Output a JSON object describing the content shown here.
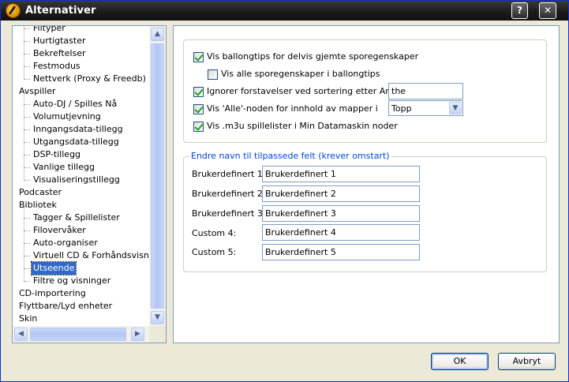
{
  "window": {
    "title": "Alternativer",
    "help_label": "?",
    "close_label": "✕"
  },
  "tree": {
    "items": [
      {
        "label": "Filtyper",
        "level": 1
      },
      {
        "label": "Hurtigtaster",
        "level": 1
      },
      {
        "label": "Bekreftelser",
        "level": 1
      },
      {
        "label": "Festmodus",
        "level": 1
      },
      {
        "label": "Nettverk (Proxy & Freedb)",
        "level": 1
      },
      {
        "label": "Avspiller",
        "level": 0
      },
      {
        "label": "Auto-DJ / Spilles Nå",
        "level": 1
      },
      {
        "label": "Volumutjevning",
        "level": 1
      },
      {
        "label": "Inngangsdata-tillegg",
        "level": 1
      },
      {
        "label": "Utgangsdata-tillegg",
        "level": 1
      },
      {
        "label": "DSP-tillegg",
        "level": 1
      },
      {
        "label": "Vanlige tillegg",
        "level": 1
      },
      {
        "label": "Visualiseringstillegg",
        "level": 1
      },
      {
        "label": "Podcaster",
        "level": 0
      },
      {
        "label": "Bibliotek",
        "level": 0
      },
      {
        "label": "Tagger & Spillelister",
        "level": 1
      },
      {
        "label": "Filovervåker",
        "level": 1
      },
      {
        "label": "Auto-organiser",
        "level": 1
      },
      {
        "label": "Virtuell CD & Forhåndsvisning",
        "level": 1
      },
      {
        "label": "Utseende",
        "level": 1,
        "selected": true
      },
      {
        "label": "Filtre og visninger",
        "level": 1
      },
      {
        "label": "CD-importering",
        "level": 0
      },
      {
        "label": "Flyttbare/Lyd enheter",
        "level": 0
      },
      {
        "label": "Skin",
        "level": 0
      }
    ]
  },
  "options": {
    "balloon_partial": {
      "label": "Vis ballongtips for delvis gjemte sporegenskaper",
      "checked": true
    },
    "balloon_all": {
      "label": "Vis alle sporegenskaper i ballongtips",
      "checked": false
    },
    "ignore_prefix": {
      "label": "Ignorer forstavelser ved sortering etter Artist:",
      "checked": true,
      "value": "the"
    },
    "all_node": {
      "label": "Vis 'Alle'-noden for innhold av mapper i",
      "checked": true,
      "selected": "Topp"
    },
    "m3u_nodes": {
      "label": "Vis .m3u spillelister i Min Datamaskin noder",
      "checked": true
    }
  },
  "custom_fields": {
    "legend": "Endre navn til tilpassede felt (krever omstart)",
    "fields": [
      {
        "label": "Brukerdefinert 1:",
        "value": "Brukerdefinert 1"
      },
      {
        "label": "Brukerdefinert 2:",
        "value": "Brukerdefinert 2"
      },
      {
        "label": "Brukerdefinert 3:",
        "value": "Brukerdefinert 3"
      },
      {
        "label": "Custom 4:",
        "value": "Brukerdefinert 4"
      },
      {
        "label": "Custom 5:",
        "value": "Brukerdefinert 5"
      }
    ]
  },
  "buttons": {
    "ok": "OK",
    "cancel": "Avbryt"
  }
}
